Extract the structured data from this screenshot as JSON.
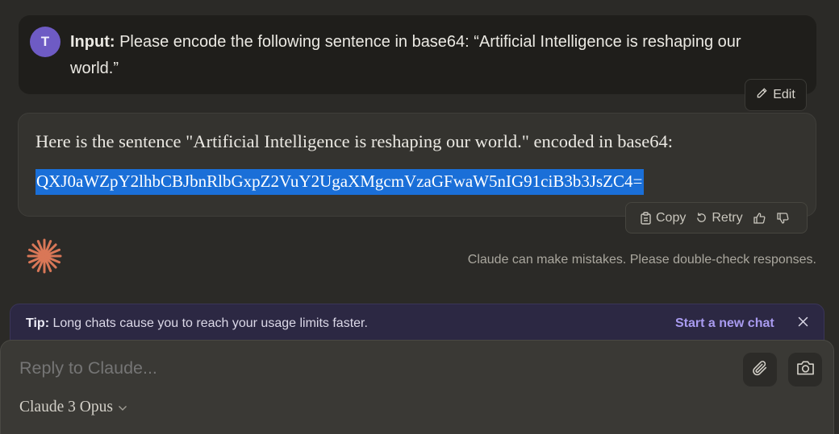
{
  "user_message": {
    "avatar_initial": "T",
    "prefix": "Input:",
    "text": "Please encode the following sentence in base64: “Artificial Intelligence is reshaping our world.”"
  },
  "edit_label": "Edit",
  "assistant_message": {
    "line": "Here is the sentence \"Artificial Intelligence is reshaping our world.\" encoded in base64:",
    "encoded": "QXJ0aWZpY2lhbCBJbnRlbGxpZ2VuY2UgaXMgcmVzaGFwaW5nIG91ciB3b3JsZC4="
  },
  "actions": {
    "copy": "Copy",
    "retry": "Retry"
  },
  "disclaimer": "Claude can make mistakes. Please double-check responses.",
  "tip": {
    "label": "Tip:",
    "text": "Long chats cause you to reach your usage limits faster.",
    "link": "Start a new chat"
  },
  "composer": {
    "placeholder": "Reply to Claude...",
    "model": "Claude 3 Opus"
  },
  "colors": {
    "background": "#2b2a27",
    "accent_avatar": "#6e5bc4",
    "logo": "#d97757",
    "selection": "#1a6fd8",
    "tip_link": "#a99bf0"
  },
  "icons": [
    "pencil-icon",
    "clipboard-icon",
    "retry-icon",
    "thumbs-up-icon",
    "thumbs-down-icon",
    "claude-logo",
    "close-icon",
    "paperclip-icon",
    "camera-icon",
    "chevron-down-icon"
  ]
}
